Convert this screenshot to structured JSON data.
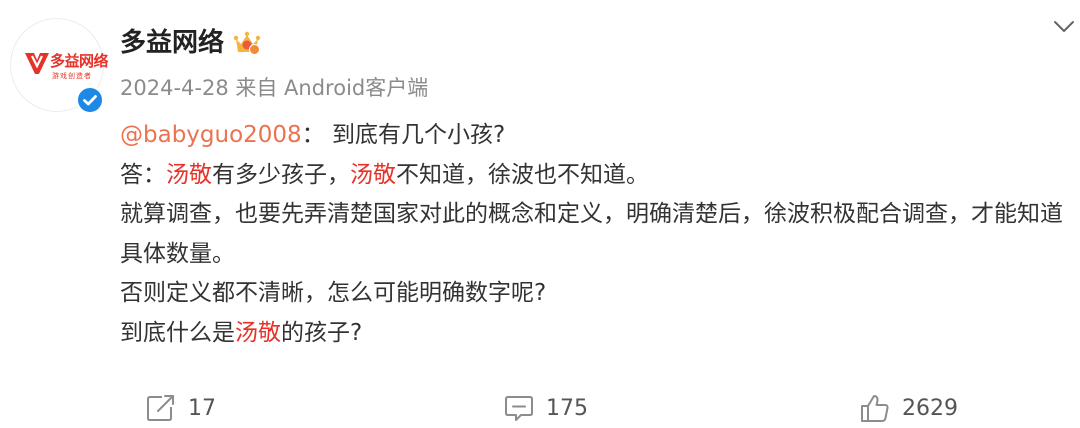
{
  "post": {
    "author": {
      "name": "多益网络",
      "avatar_logo_text": "多益网络",
      "avatar_logo_sub": "游戏创造者",
      "verified_color": "#1e88e5"
    },
    "meta": {
      "date": "2024-4-28",
      "source": "来自 Android客户端"
    },
    "content": {
      "line1": {
        "mention": "@babyguo2008",
        "text": "： 到底有几个小孩?"
      },
      "line2": {
        "prefix": "答：",
        "tag1": "汤敬",
        "mid1": "有多少孩子，",
        "tag2": "汤敬",
        "rest": "不知道，徐波也不知道。"
      },
      "line3": {
        "text": "就算调查，也要先弄清楚国家对此的概念和定义，明确清楚后，徐波积极配合调查，才能知道具体数量。"
      },
      "line4": {
        "text": "否则定义都不清晰，怎么可能明确数字呢?"
      },
      "line5": {
        "prefix": "到底什么是",
        "tag": "汤敬",
        "suffix": "的孩子?"
      }
    },
    "actions": {
      "repost_count": "17",
      "comment_count": "175",
      "like_count": "2629"
    },
    "colors": {
      "mention": "#eb7350",
      "tag": "#e5332a",
      "meta": "#8b8b8b"
    }
  }
}
